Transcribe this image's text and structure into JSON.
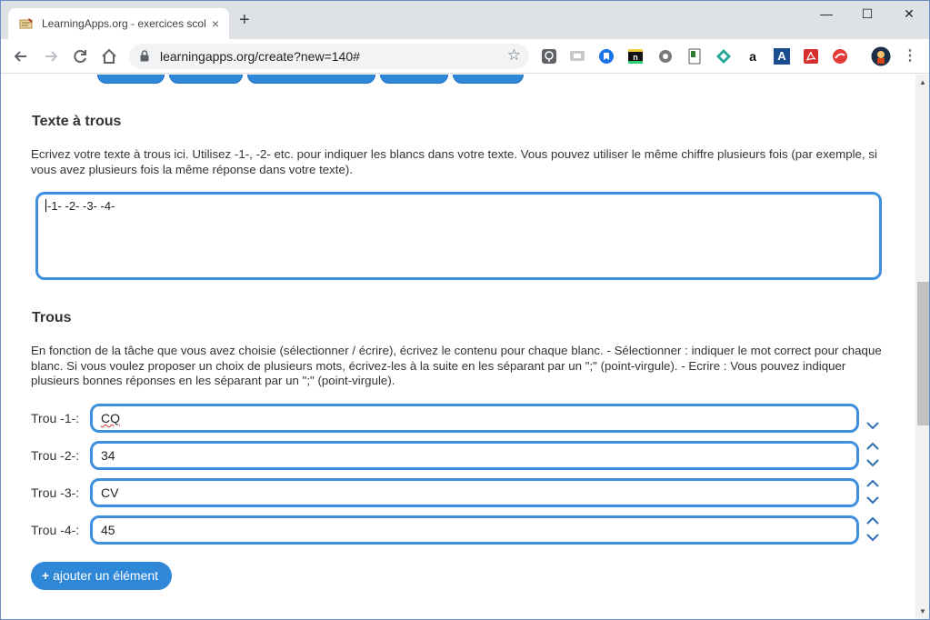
{
  "browser": {
    "tab_title": "LearningApps.org - exercices scol",
    "url": "learningapps.org/create?new=140#",
    "tab_close": "×",
    "new_tab": "+",
    "window_controls": [
      "—",
      "☐",
      "✕"
    ]
  },
  "extensions": [
    "lightbulb-icon",
    "translate-icon",
    "bookmark-icon",
    "notion-icon",
    "settings-icon",
    "note-icon",
    "diamond-icon",
    "amazon-icon",
    "a-icon",
    "pdf-icon",
    "trend-icon",
    "avatar"
  ],
  "extension_glyphs": {
    "amazon": "a",
    "a_letter": "A"
  },
  "section1": {
    "title": "Texte à trous",
    "instructions": "Ecrivez votre texte à trous ici. Utilisez -1-, -2- etc. pour indiquer les blancs dans votre texte. Vous pouvez utiliser le même chiffre plusieurs fois (par exemple, si vous avez plusieurs fois la même réponse dans votre texte).",
    "text_value": "-1-  -2-  -3-  -4-"
  },
  "section2": {
    "title": "Trous",
    "instructions": "En fonction de la tâche que vous avez choisie (sélectionner / écrire), écrivez le contenu pour chaque blanc. - Sélectionner : indiquer le mot correct pour chaque blanc. Si vous voulez proposer un choix de plusieurs mots, écrivez-les à la suite en les séparant par un \";\" (point-virgule). - Ecrire : Vous pouvez indiquer plusieurs bonnes réponses en les séparant par un \";\" (point-virgule).",
    "rows": [
      {
        "label": "Trou -1-:",
        "value": "CQ"
      },
      {
        "label": "Trou -2-:",
        "value": "34"
      },
      {
        "label": "Trou -3-:",
        "value": "CV"
      },
      {
        "label": "Trou -4-:",
        "value": "45"
      }
    ],
    "add_button": "ajouter un élément",
    "add_icon": "+"
  },
  "colors": {
    "accent": "#3e8fde",
    "button": "#2f87d8"
  }
}
